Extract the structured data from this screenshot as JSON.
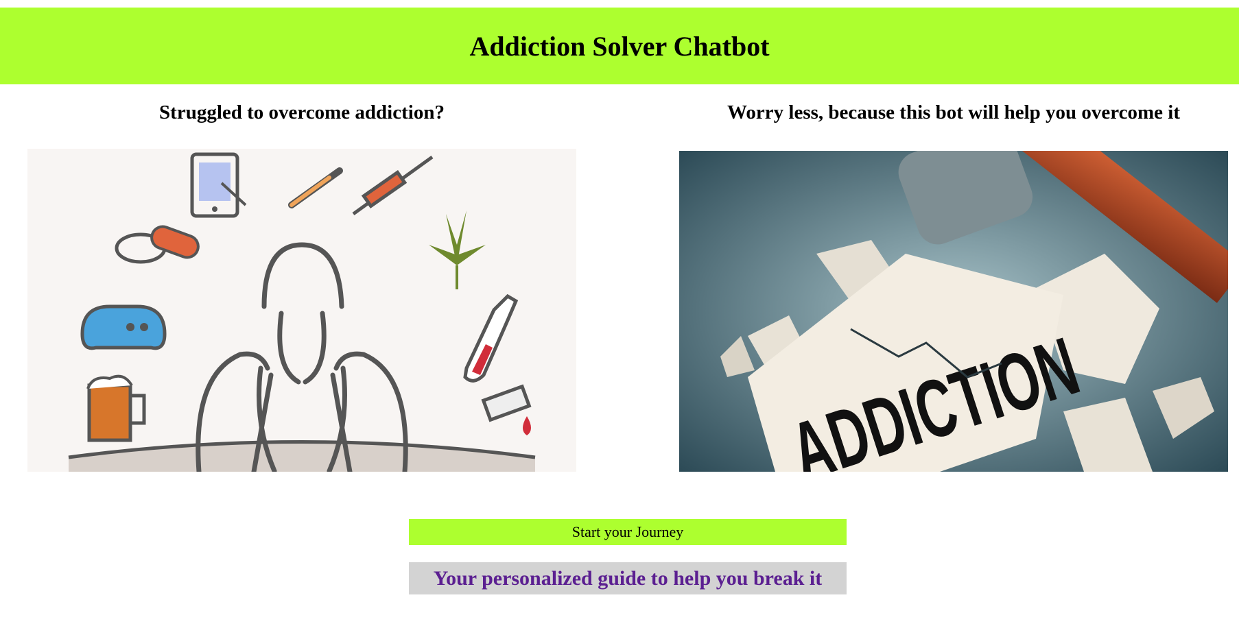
{
  "header": {
    "title": "Addiction Solver Chatbot"
  },
  "left_column": {
    "heading": "Struggled to overcome addiction?",
    "image_description_icon": "person-with-addiction-icons-illustration"
  },
  "right_column": {
    "heading": "Worry less, because this bot will help you overcome it",
    "image_word": "ADDICTION"
  },
  "actions": {
    "start_label": "Start your Journey"
  },
  "tagline": {
    "text": "Your personalized guide to help you break it"
  },
  "colors": {
    "accent": "#adff2f",
    "tagline_bg": "#d3d3d3",
    "tagline_text": "#5b1f91"
  }
}
